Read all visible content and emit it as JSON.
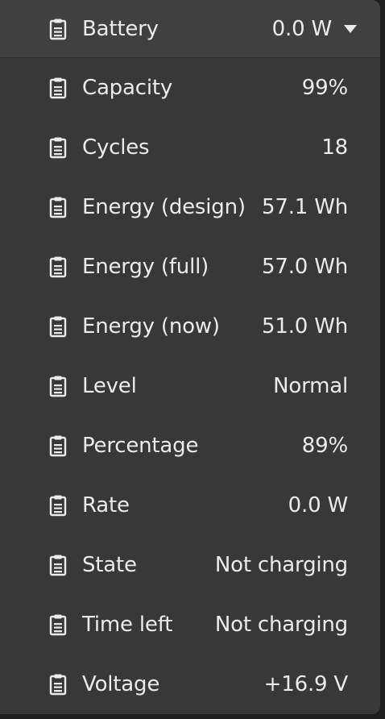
{
  "header": {
    "label": "Battery",
    "value": "0.0 W",
    "icon": "clipboard-icon",
    "toggle_icon": "triangle-down-icon"
  },
  "rows": [
    {
      "label": "Capacity",
      "value": "99%"
    },
    {
      "label": "Cycles",
      "value": "18"
    },
    {
      "label": "Energy (design)",
      "value": "57.1 Wh"
    },
    {
      "label": "Energy (full)",
      "value": "57.0 Wh"
    },
    {
      "label": "Energy (now)",
      "value": "51.0 Wh"
    },
    {
      "label": "Level",
      "value": "Normal"
    },
    {
      "label": "Percentage",
      "value": "89%"
    },
    {
      "label": "Rate",
      "value": "0.0 W"
    },
    {
      "label": "State",
      "value": "Not charging"
    },
    {
      "label": "Time left",
      "value": "Not charging"
    },
    {
      "label": "Voltage",
      "value": "+16.9 V"
    }
  ],
  "colors": {
    "panel": "#383838",
    "header": "#404040",
    "text": "#ebebeb"
  }
}
